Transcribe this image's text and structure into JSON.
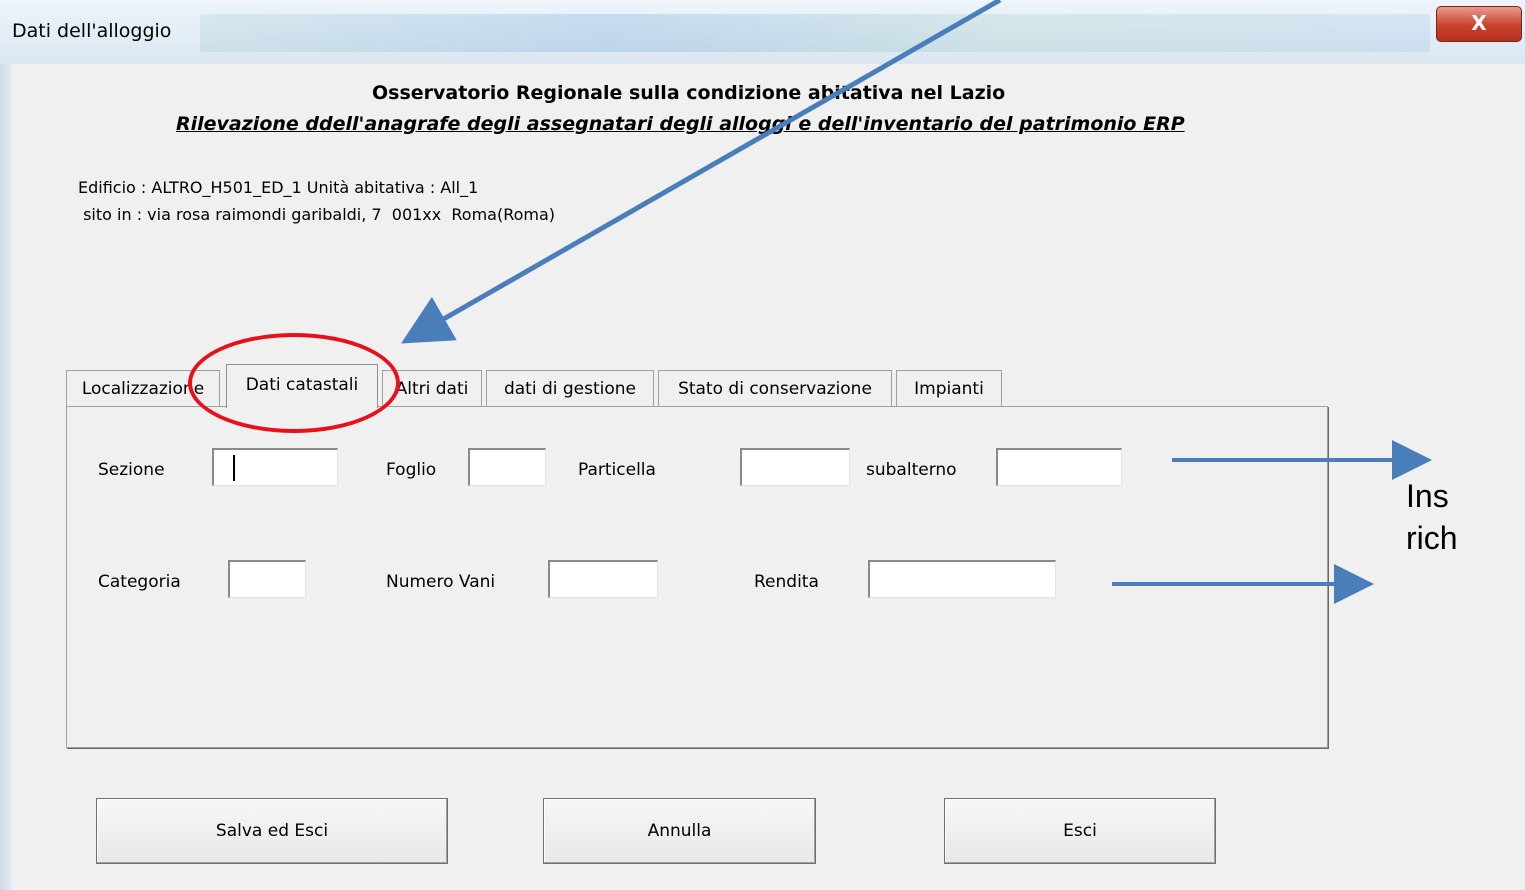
{
  "window": {
    "title": "Dati dell'alloggio",
    "close_glyph": "X"
  },
  "header": {
    "title": "Osservatorio Regionale sulla condizione abitativa nel Lazio",
    "subtitle": "Rilevazione ddell'anagrafe degli assegnatari degli alloggi e dell'inventario del patrimonio ERP"
  },
  "info": {
    "line1": "Edificio : ALTRO_H501_ED_1 Unità abitativa : All_1",
    "line2": " sito in : via rosa raimondi garibaldi, 7  001xx  Roma(Roma)"
  },
  "tabs": [
    {
      "label": "Localizzazione",
      "active": false
    },
    {
      "label": "Dati catastali",
      "active": true
    },
    {
      "label": "Altri dati",
      "active": false
    },
    {
      "label": "dati di gestione",
      "active": false
    },
    {
      "label": "Stato di conservazione",
      "active": false
    },
    {
      "label": "Impianti",
      "active": false
    }
  ],
  "form": {
    "sezione": {
      "label": "Sezione",
      "value": ""
    },
    "foglio": {
      "label": "Foglio",
      "value": ""
    },
    "particella": {
      "label": "Particella",
      "value": ""
    },
    "subalterno": {
      "label": "subalterno",
      "value": ""
    },
    "categoria": {
      "label": "Categoria",
      "value": ""
    },
    "numero_vani": {
      "label": "Numero Vani",
      "value": ""
    },
    "rendita": {
      "label": "Rendita",
      "value": ""
    }
  },
  "buttons": {
    "save": "Salva ed Esci",
    "cancel": "Annulla",
    "exit": "Esci"
  },
  "annotations": {
    "note_line1": "Ins",
    "note_line2": "rich",
    "arrow_color": "#4a7ebb",
    "highlight_color": "#e8101a"
  }
}
